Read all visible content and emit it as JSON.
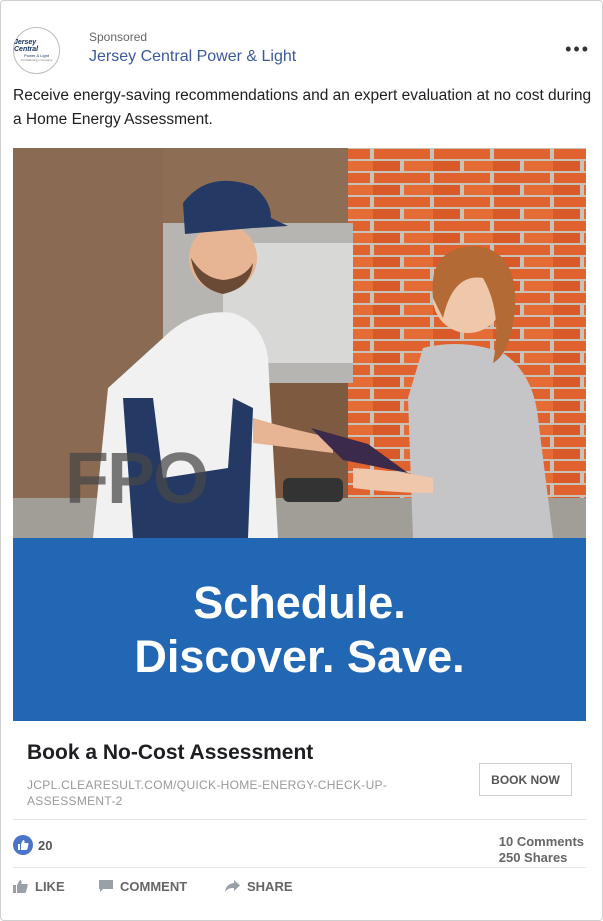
{
  "post": {
    "sponsored_label": "Sponsored",
    "page_name": "Jersey Central Power & Light",
    "logo": {
      "line1": "Jersey Central",
      "line2": "Power & Light",
      "line3": "A FirstEnergy Company"
    },
    "more_icon": "•••",
    "caption": "Receive energy-saving recommendations and an expert evaluation at no cost during a Home Energy Assessment."
  },
  "hero": {
    "watermark": "FPO",
    "headline_line1": "Schedule.",
    "headline_line2": "Discover. Save."
  },
  "link": {
    "title": "Book a No-Cost Assessment",
    "url": "JCPL.CLEARESULT.COM/QUICK-HOME-ENERGY-CHECK-UP-ASSESSMENT-2",
    "button_label": "BOOK NOW"
  },
  "reactions": {
    "likes": "20",
    "comments": "10 Comments",
    "shares": "250 Shares"
  },
  "actions": {
    "like": "LIKE",
    "comment": "COMMENT",
    "share": "SHARE"
  },
  "colors": {
    "banner": "#2167b3",
    "page_name": "#3b5998",
    "like_badge": "#4a74c9"
  }
}
